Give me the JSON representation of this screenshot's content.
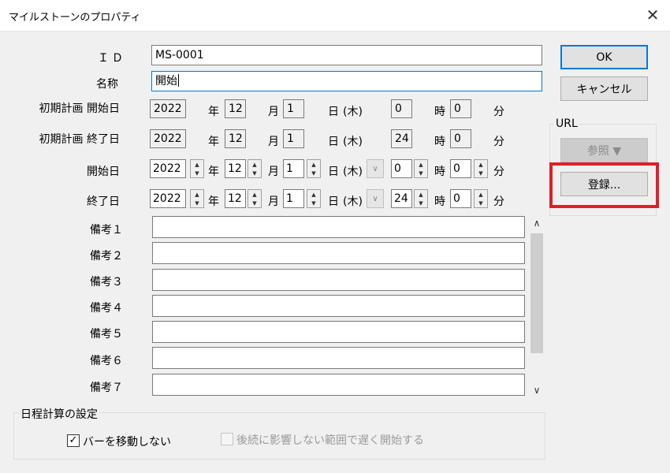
{
  "window": {
    "title": "マイルストーンのプロパティ",
    "close_icon": "✕"
  },
  "fields": {
    "id_label": "ＩＤ",
    "id_value": "MS-0001",
    "name_label": "名称",
    "name_value": "開始"
  },
  "units": {
    "year": "年",
    "month": "月",
    "day": "日",
    "hour": "時",
    "minute": "分"
  },
  "planned_start": {
    "label": "初期計画 開始日",
    "year": "2022",
    "month": "12",
    "day": "1",
    "weekday": "(木)",
    "hour": "0",
    "minute": "0"
  },
  "planned_end": {
    "label": "初期計画 終了日",
    "year": "2022",
    "month": "12",
    "day": "1",
    "weekday": "(木)",
    "hour": "24",
    "minute": "0"
  },
  "start": {
    "label": "開始日",
    "year": "2022",
    "month": "12",
    "day": "1",
    "weekday": "(木)",
    "hour": "0",
    "minute": "0"
  },
  "end": {
    "label": "終了日",
    "year": "2022",
    "month": "12",
    "day": "1",
    "weekday": "(木)",
    "hour": "24",
    "minute": "0"
  },
  "notes": [
    {
      "label": "備考１",
      "value": ""
    },
    {
      "label": "備考２",
      "value": ""
    },
    {
      "label": "備考３",
      "value": ""
    },
    {
      "label": "備考４",
      "value": ""
    },
    {
      "label": "備考５",
      "value": ""
    },
    {
      "label": "備考６",
      "value": ""
    },
    {
      "label": "備考７",
      "value": ""
    }
  ],
  "buttons": {
    "ok": "OK",
    "cancel": "キャンセル"
  },
  "url_group": {
    "label": "URL",
    "browse": "参照 ▼",
    "register": "登録..."
  },
  "schedule_group": {
    "label": "日程計算の設定",
    "no_move_bar": {
      "label": "バーを移動しない",
      "checked": true
    },
    "delay_start": {
      "label": "後続に影響しない範囲で遅く開始する",
      "checked": false,
      "enabled": false
    }
  },
  "colors": {
    "accent": "#0078d7",
    "highlight": "#e01e2a"
  }
}
